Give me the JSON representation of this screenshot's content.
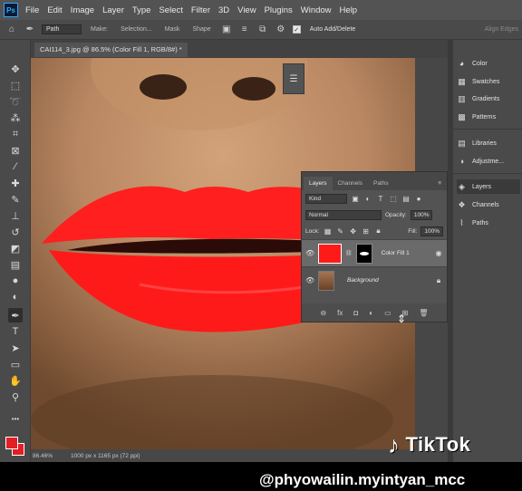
{
  "app": {
    "logo": "Ps"
  },
  "menu": [
    "File",
    "Edit",
    "Image",
    "Layer",
    "Type",
    "Select",
    "Filter",
    "3D",
    "View",
    "Plugins",
    "Window",
    "Help"
  ],
  "options_bar": {
    "mode": "Path",
    "make_label": "Make:",
    "selection_btn": "Selection...",
    "mask_btn": "Mask",
    "shape_btn": "Shape",
    "auto_add_delete": "Auto Add/Delete",
    "align_edges": "Align Edges"
  },
  "document": {
    "tab_title": "CAI114_3.jpg @ 86.5% (Color Fill 1, RGB/8#) *",
    "zoom": "86.46%",
    "doc_info": "1000 px x 1165 px (72 ppi)"
  },
  "colors": {
    "foreground": "#e31e24",
    "lipstick": "#ff1a1a"
  },
  "right_panel": {
    "items": [
      {
        "label": "Color",
        "icon": "color-wheel-icon"
      },
      {
        "label": "Swatches",
        "icon": "swatches-grid-icon"
      },
      {
        "label": "Gradients",
        "icon": "gradient-icon"
      },
      {
        "label": "Patterns",
        "icon": "patterns-icon"
      },
      {
        "label": "Libraries",
        "icon": "libraries-icon"
      },
      {
        "label": "Adjustme...",
        "icon": "adjustments-icon"
      },
      {
        "label": "Layers",
        "icon": "layers-icon"
      },
      {
        "label": "Channels",
        "icon": "channels-icon"
      },
      {
        "label": "Paths",
        "icon": "paths-icon"
      }
    ]
  },
  "layers_panel": {
    "tabs": [
      "Layers",
      "Channels",
      "Paths"
    ],
    "filter_kind": "Kind",
    "blend_mode": "Normal",
    "opacity_label": "Opacity:",
    "opacity_value": "100%",
    "lock_label": "Lock:",
    "fill_label": "Fill:",
    "fill_value": "100%",
    "layers": [
      {
        "name": "Color Fill 1",
        "selected": true
      },
      {
        "name": "Background",
        "selected": false
      }
    ]
  },
  "overlay": {
    "tiktok_brand": "TikTok",
    "handle": "@phyowailin.myintyan_mcc"
  }
}
